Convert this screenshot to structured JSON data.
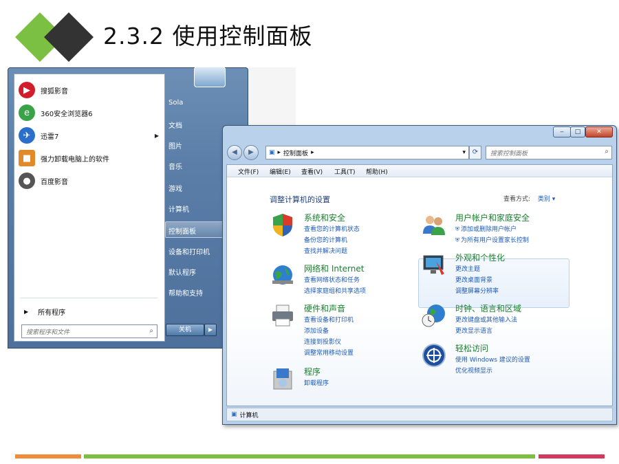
{
  "slide": {
    "title": "2.3.2  使用控制面板"
  },
  "start_menu": {
    "programs": [
      {
        "label": "搜狐影音",
        "icon": "sohu-video-icon",
        "color": "#d21e2b"
      },
      {
        "label": "360安全浏览器6",
        "icon": "360-browser-icon",
        "color": "#3aa34a"
      },
      {
        "label": "迅雷7",
        "icon": "thunder-icon",
        "color": "#2a6fcb",
        "has_submenu": true
      },
      {
        "label": "强力卸载电脑上的软件",
        "icon": "uninstall-box-icon",
        "color": "#e08a2a"
      },
      {
        "label": "百度影音",
        "icon": "baidu-video-icon",
        "color": "#555555"
      }
    ],
    "all_programs": "所有程序",
    "search_placeholder": "搜索程序和文件",
    "right_items": [
      "Sola",
      "文档",
      "图片",
      "音乐",
      "游戏",
      "计算机",
      "控制面板",
      "设备和打印机",
      "默认程序",
      "帮助和支持"
    ],
    "highlighted_item": "控制面板",
    "shutdown_label": "关机"
  },
  "control_panel": {
    "address": "控制面板",
    "search_placeholder": "搜索控制面板",
    "menu": [
      "文件(F)",
      "编辑(E)",
      "查看(V)",
      "工具(T)",
      "帮助(H)"
    ],
    "heading": "调整计算机的设置",
    "view_by_label": "查看方式:",
    "view_by_value": "类别",
    "categories_left": [
      {
        "title": "系统和安全",
        "icon": "security-shield-icon",
        "links": [
          "查看您的计算机状态",
          "备份您的计算机",
          "查找并解决问题"
        ]
      },
      {
        "title": "网络和 Internet",
        "icon": "network-globe-icon",
        "links": [
          "查看网络状态和任务",
          "选择家庭组和共享选项"
        ]
      },
      {
        "title": "硬件和声音",
        "icon": "printer-hardware-icon",
        "links": [
          "查看设备和打印机",
          "添加设备",
          "连接到投影仪",
          "调整常用移动设置"
        ]
      },
      {
        "title": "程序",
        "icon": "programs-box-icon",
        "links": [
          "卸载程序"
        ]
      }
    ],
    "categories_right": [
      {
        "title": "用户帐户和家庭安全",
        "icon": "users-icon",
        "links": [
          "添加或删除用户帐户",
          "为所有用户设置家长控制"
        ]
      },
      {
        "title": "外观和个性化",
        "icon": "appearance-monitor-icon",
        "links": [
          "更改主题",
          "更改桌面背景",
          "调整屏幕分辨率"
        ]
      },
      {
        "title": "时钟、语言和区域",
        "icon": "clock-globe-icon",
        "links": [
          "更改键盘或其他输入法",
          "更改显示语言"
        ]
      },
      {
        "title": "轻松访问",
        "icon": "ease-of-access-icon",
        "links": [
          "使用 Windows 建议的设置",
          "优化视频显示"
        ]
      }
    ],
    "status_bar": "计算机"
  },
  "colors": {
    "green": "#7bc043",
    "orange": "#f08c3c",
    "pink": "#d23a5e",
    "title_green": "#1a7f2e",
    "link_blue": "#1e5bb8"
  }
}
